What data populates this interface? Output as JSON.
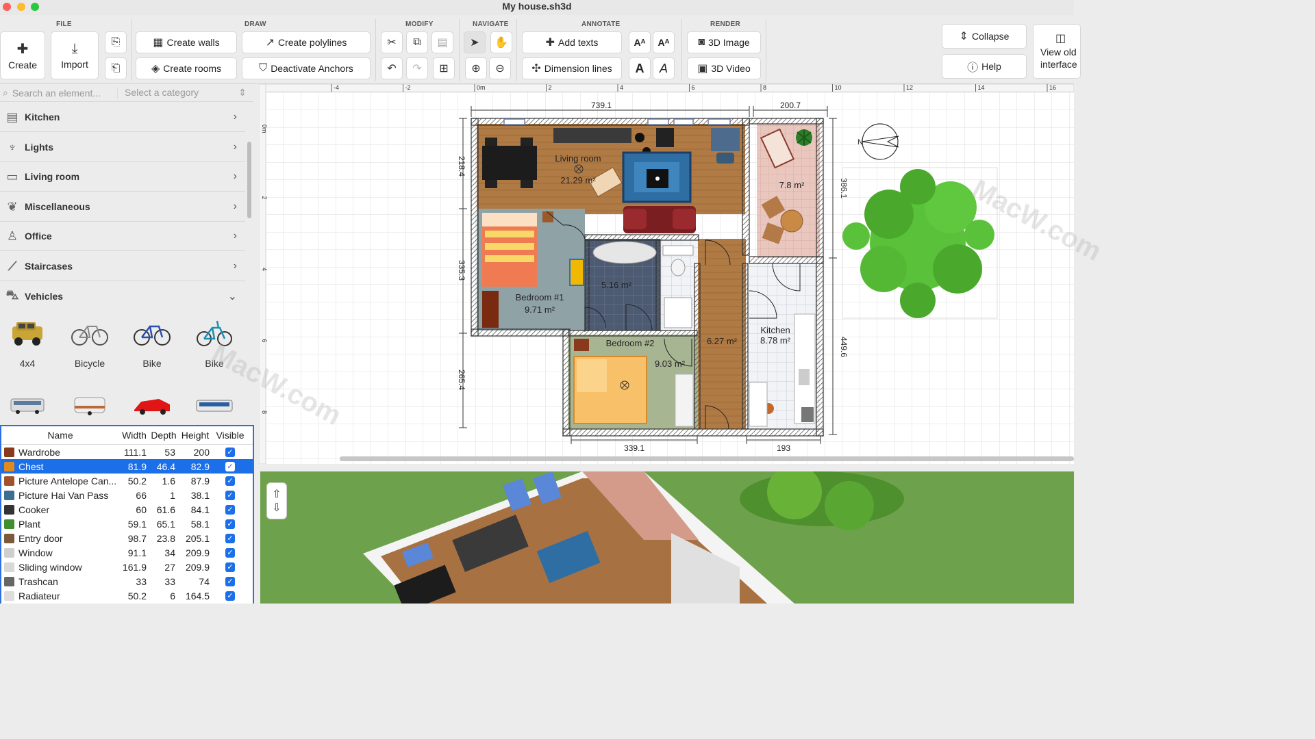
{
  "window": {
    "title": "My house.sh3d"
  },
  "toolbar": {
    "groups": {
      "file": "FILE",
      "draw": "DRAW",
      "modify": "MODIFY",
      "navigate": "NAVIGATE",
      "annotate": "ANNOTATE",
      "render": "RENDER"
    },
    "create": "Create",
    "import": "Import",
    "create_walls": "Create walls",
    "create_rooms": "Create rooms",
    "create_polylines": "Create polylines",
    "deactivate_anchors": "Deactivate Anchors",
    "add_texts": "Add texts",
    "dimension_lines": "Dimension lines",
    "image_3d": "3D Image",
    "video_3d": "3D Video",
    "collapse": "Collapse",
    "help": "Help",
    "view_old_1": "View old",
    "view_old_2": "interface"
  },
  "catalog": {
    "search_placeholder": "Search an element...",
    "category_placeholder": "Select a category",
    "categories": [
      "Kitchen",
      "Lights",
      "Living room",
      "Miscellaneous",
      "Office",
      "Staircases",
      "Vehicles"
    ],
    "vehicles": [
      "4x4",
      "Bicycle",
      "Bike",
      "Bike"
    ]
  },
  "table": {
    "headers": [
      "Name",
      "Width",
      "Depth",
      "Height",
      "Visible"
    ],
    "rows": [
      {
        "name": "Wardrobe",
        "w": "111.1",
        "d": "53",
        "h": "200",
        "color": "#8a3a1c"
      },
      {
        "name": "Chest",
        "w": "81.9",
        "d": "46.4",
        "h": "82.9",
        "color": "#e28a1e"
      },
      {
        "name": "Picture Antelope Can...",
        "w": "50.2",
        "d": "1.6",
        "h": "87.9",
        "color": "#a0522d"
      },
      {
        "name": "Picture Hai Van Pass",
        "w": "66",
        "d": "1",
        "h": "38.1",
        "color": "#3b6e8f"
      },
      {
        "name": "Cooker",
        "w": "60",
        "d": "61.6",
        "h": "84.1",
        "color": "#333333"
      },
      {
        "name": "Plant",
        "w": "59.1",
        "d": "65.1",
        "h": "58.1",
        "color": "#3f8f2f"
      },
      {
        "name": "Entry door",
        "w": "98.7",
        "d": "23.8",
        "h": "205.1",
        "color": "#7a5a3a"
      },
      {
        "name": "Window",
        "w": "91.1",
        "d": "34",
        "h": "209.9",
        "color": "#cfcfcf"
      },
      {
        "name": "Sliding window",
        "w": "161.9",
        "d": "27",
        "h": "209.9",
        "color": "#d8d8d8"
      },
      {
        "name": "Trashcan",
        "w": "33",
        "d": "33",
        "h": "74",
        "color": "#666666"
      },
      {
        "name": "Radiateur",
        "w": "50.2",
        "d": "6",
        "h": "164.5",
        "color": "#dddddd"
      }
    ]
  },
  "plan": {
    "ruler_labels": [
      "-4",
      "-2",
      "0m",
      "2",
      "4",
      "6",
      "8",
      "10",
      "12",
      "14",
      "16"
    ],
    "ruler_v_labels": [
      "0m",
      "2",
      "4",
      "6",
      "8"
    ],
    "dims": {
      "top_left": "739.1",
      "top_right": "200.7",
      "left_1": "218.4",
      "left_2": "335.3",
      "left_3": "265.4",
      "right_1": "386.1",
      "right_2": "449.6",
      "bottom_1": "339.1",
      "bottom_2": "193"
    },
    "rooms": {
      "living": "Living room",
      "living_area": "21.29 m²",
      "bed1": "Bedroom #1",
      "bed1_area": "9.71 m²",
      "bath_area": "5.16 m²",
      "bed2": "Bedroom #2",
      "bed2_area": "9.03 m²",
      "hall_area": "6.27 m²",
      "kitchen": "Kitchen",
      "kitchen_area": "8.78 m²",
      "terrace_area": "7.8 m²"
    }
  },
  "watermark": "MacW.com"
}
